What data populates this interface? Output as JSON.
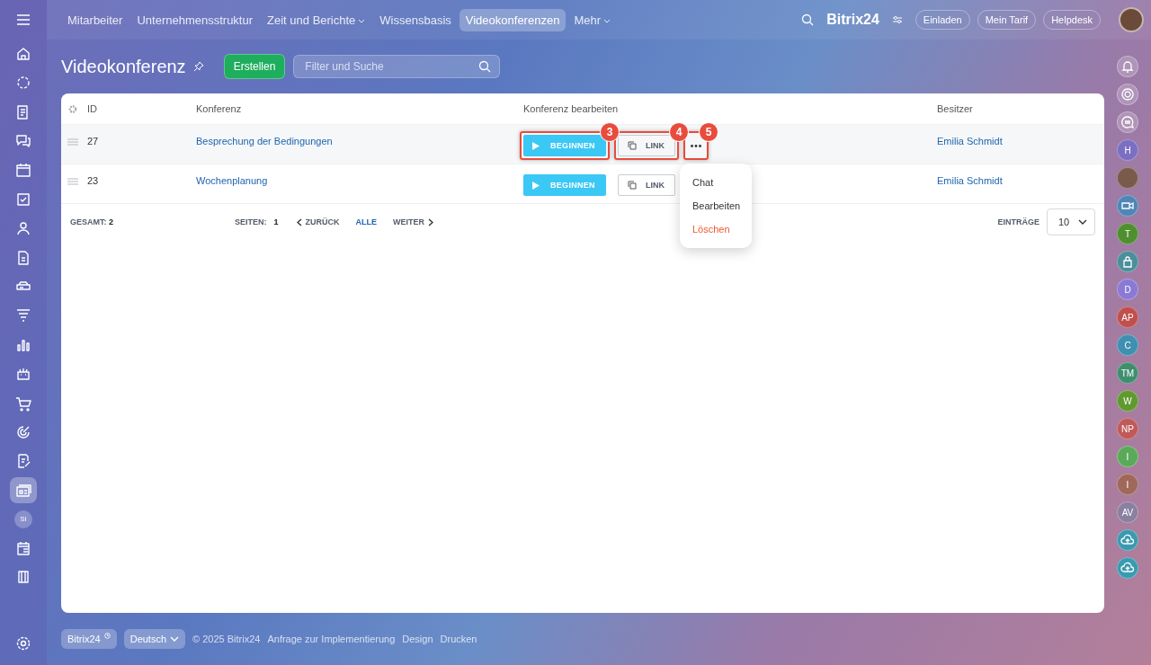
{
  "top_nav": {
    "items": [
      {
        "label": "Mitarbeiter",
        "selected": false,
        "dropdown": false
      },
      {
        "label": "Unternehmensstruktur",
        "selected": false,
        "dropdown": false
      },
      {
        "label": "Zeit und Berichte",
        "selected": false,
        "dropdown": true
      },
      {
        "label": "Wissensbasis",
        "selected": false,
        "dropdown": false
      },
      {
        "label": "Videokonferenzen",
        "selected": true,
        "dropdown": false
      },
      {
        "label": "Mehr",
        "selected": false,
        "dropdown": true
      }
    ],
    "brand": "Bitrix24",
    "buttons": [
      "Einladen",
      "Mein Tarif",
      "Helpdesk"
    ]
  },
  "left_sidebar": [
    {
      "kind": "home",
      "selected": false
    },
    {
      "kind": "collab",
      "selected": false
    },
    {
      "kind": "feed",
      "selected": false
    },
    {
      "kind": "chat",
      "selected": false
    },
    {
      "kind": "calendar",
      "selected": false
    },
    {
      "kind": "task",
      "selected": false
    },
    {
      "kind": "people",
      "selected": false
    },
    {
      "kind": "doc",
      "selected": false
    },
    {
      "kind": "drive",
      "selected": false
    },
    {
      "kind": "funnel",
      "selected": false
    },
    {
      "kind": "chart",
      "selected": false
    },
    {
      "kind": "robot",
      "selected": false
    },
    {
      "kind": "cart",
      "selected": false
    },
    {
      "kind": "target",
      "selected": false
    },
    {
      "kind": "sign",
      "selected": false
    },
    {
      "kind": "card",
      "selected": true
    },
    {
      "kind": "avatar",
      "label": "SI",
      "selected": false
    },
    {
      "kind": "schedule",
      "selected": false
    },
    {
      "kind": "box",
      "selected": false
    }
  ],
  "page": {
    "title": "Videokonferenz",
    "create_button": "Erstellen",
    "filter_placeholder": "Filter und Suche"
  },
  "table": {
    "columns": [
      "ID",
      "Konferenz",
      "Konferenz bearbeiten",
      "Besitzer"
    ],
    "rows": [
      {
        "id": "27",
        "name": "Besprechung der Bedingungen",
        "start": "BEGINNEN",
        "link": "LINK",
        "owner": "Emilia Schmidt",
        "selected": true,
        "callouts": [
          "3",
          "4",
          "5"
        ]
      },
      {
        "id": "23",
        "name": "Wochenplanung",
        "start": "BEGINNEN",
        "link": "LINK",
        "owner": "Emilia Schmidt",
        "selected": false,
        "callouts": []
      }
    ],
    "menu": [
      {
        "label": "Chat",
        "kind": "normal"
      },
      {
        "label": "Bearbeiten",
        "kind": "normal"
      },
      {
        "label": "Löschen",
        "kind": "danger"
      }
    ],
    "footer": {
      "total_label": "GESAMT:",
      "total": "2",
      "pages_label": "SEITEN:",
      "page": "1",
      "prev": "ZURÜCK",
      "all": "ALLE",
      "next": "WEITER",
      "entries_label": "EINTRÄGE",
      "entries": "10"
    }
  },
  "right_sidebar": [
    {
      "kind": "bell"
    },
    {
      "kind": "target"
    },
    {
      "kind": "chat"
    },
    {
      "kind": "letter",
      "label": "H",
      "color": "#7b6fc4"
    },
    {
      "kind": "photo"
    },
    {
      "kind": "video",
      "color": "#4f86b8"
    },
    {
      "kind": "letter",
      "label": "T",
      "color": "#4f8f2f"
    },
    {
      "kind": "lock",
      "color": "#4a8f9a"
    },
    {
      "kind": "letter",
      "label": "D",
      "color": "#8a7ad6"
    },
    {
      "kind": "letter",
      "label": "AP",
      "color": "#c0504d"
    },
    {
      "kind": "letter",
      "label": "C",
      "color": "#3f8fb0"
    },
    {
      "kind": "letter",
      "label": "TM",
      "color": "#3f8f6f"
    },
    {
      "kind": "letter",
      "label": "W",
      "color": "#5f9a2f"
    },
    {
      "kind": "letter",
      "label": "NP",
      "color": "#c05a5a"
    },
    {
      "kind": "letter",
      "label": "I",
      "color": "#5aaa5a"
    },
    {
      "kind": "letter",
      "label": "I",
      "color": "#a0685a"
    },
    {
      "kind": "letter",
      "label": "AV",
      "color": "#8a80a0"
    },
    {
      "kind": "cloud",
      "color": "#3a9ab0"
    },
    {
      "kind": "cloud",
      "color": "#3a9ab0"
    }
  ],
  "footer": {
    "brand": "Bitrix24",
    "language": "Deutsch",
    "copyright": "© 2025 Bitrix24",
    "links": [
      "Anfrage zur Implementierung",
      "Design",
      "Drucken"
    ]
  }
}
